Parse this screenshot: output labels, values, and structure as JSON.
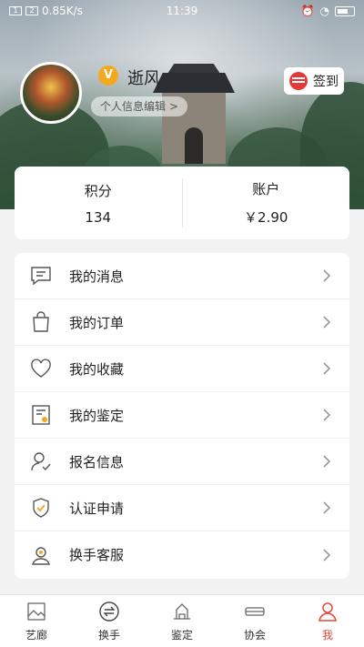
{
  "status_bar": {
    "left_text": "0.85K/s",
    "time": "11:39"
  },
  "profile": {
    "vip_badge": "V",
    "username": "逝风",
    "edit_profile": "个人信息编辑 >",
    "checkin_label": "签到"
  },
  "stats": {
    "points_label": "积分",
    "points_value": "134",
    "account_label": "账户",
    "account_value": "￥2.90"
  },
  "menu": {
    "items": [
      {
        "label": "我的消息",
        "icon": "message-icon"
      },
      {
        "label": "我的订单",
        "icon": "shopping-bag-icon"
      },
      {
        "label": "我的收藏",
        "icon": "heart-icon"
      },
      {
        "label": "我的鉴定",
        "icon": "certificate-icon"
      },
      {
        "label": "报名信息",
        "icon": "user-check-icon"
      },
      {
        "label": "认证申请",
        "icon": "shield-check-icon"
      },
      {
        "label": "换手客服",
        "icon": "customer-service-icon"
      }
    ]
  },
  "tabbar": {
    "items": [
      {
        "label": "艺廊",
        "icon": "gallery-icon"
      },
      {
        "label": "换手",
        "icon": "exchange-icon"
      },
      {
        "label": "鉴定",
        "icon": "appraisal-icon"
      },
      {
        "label": "协会",
        "icon": "association-icon"
      },
      {
        "label": "我",
        "icon": "profile-icon",
        "active": true
      }
    ]
  },
  "colors": {
    "accent": "#e0483e",
    "vip": "#f3a81d",
    "icon_stroke": "#555555"
  }
}
